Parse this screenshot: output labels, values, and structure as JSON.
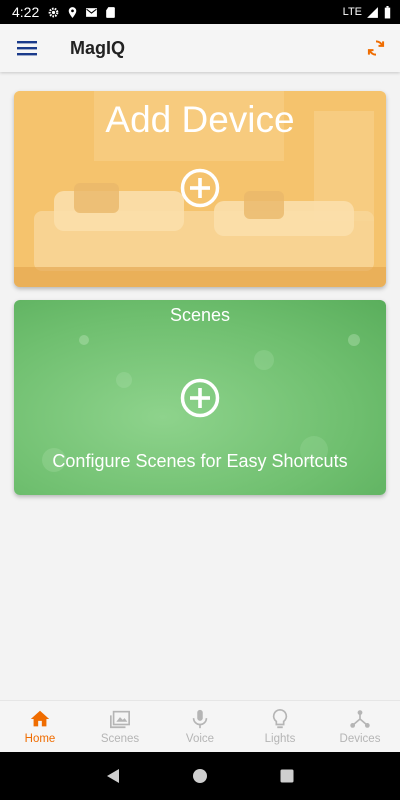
{
  "status_bar": {
    "time": "4:22",
    "network": "LTE"
  },
  "app": {
    "title": "MagIQ"
  },
  "cards": {
    "add_device": {
      "title": "Add Device"
    },
    "scenes": {
      "title": "Scenes",
      "subtitle": "Configure Scenes for Easy Shortcuts"
    }
  },
  "bottom_nav": {
    "items": [
      {
        "label": "Home",
        "icon": "home-icon",
        "active": true
      },
      {
        "label": "Scenes",
        "icon": "photos-icon",
        "active": false
      },
      {
        "label": "Voice",
        "icon": "microphone-icon",
        "active": false
      },
      {
        "label": "Lights",
        "icon": "lightbulb-icon",
        "active": false
      },
      {
        "label": "Devices",
        "icon": "network-icon",
        "active": false
      }
    ]
  },
  "colors": {
    "accent": "#ef6c00",
    "menu": "#1a3a8a",
    "inactive": "#b5b5b5"
  }
}
